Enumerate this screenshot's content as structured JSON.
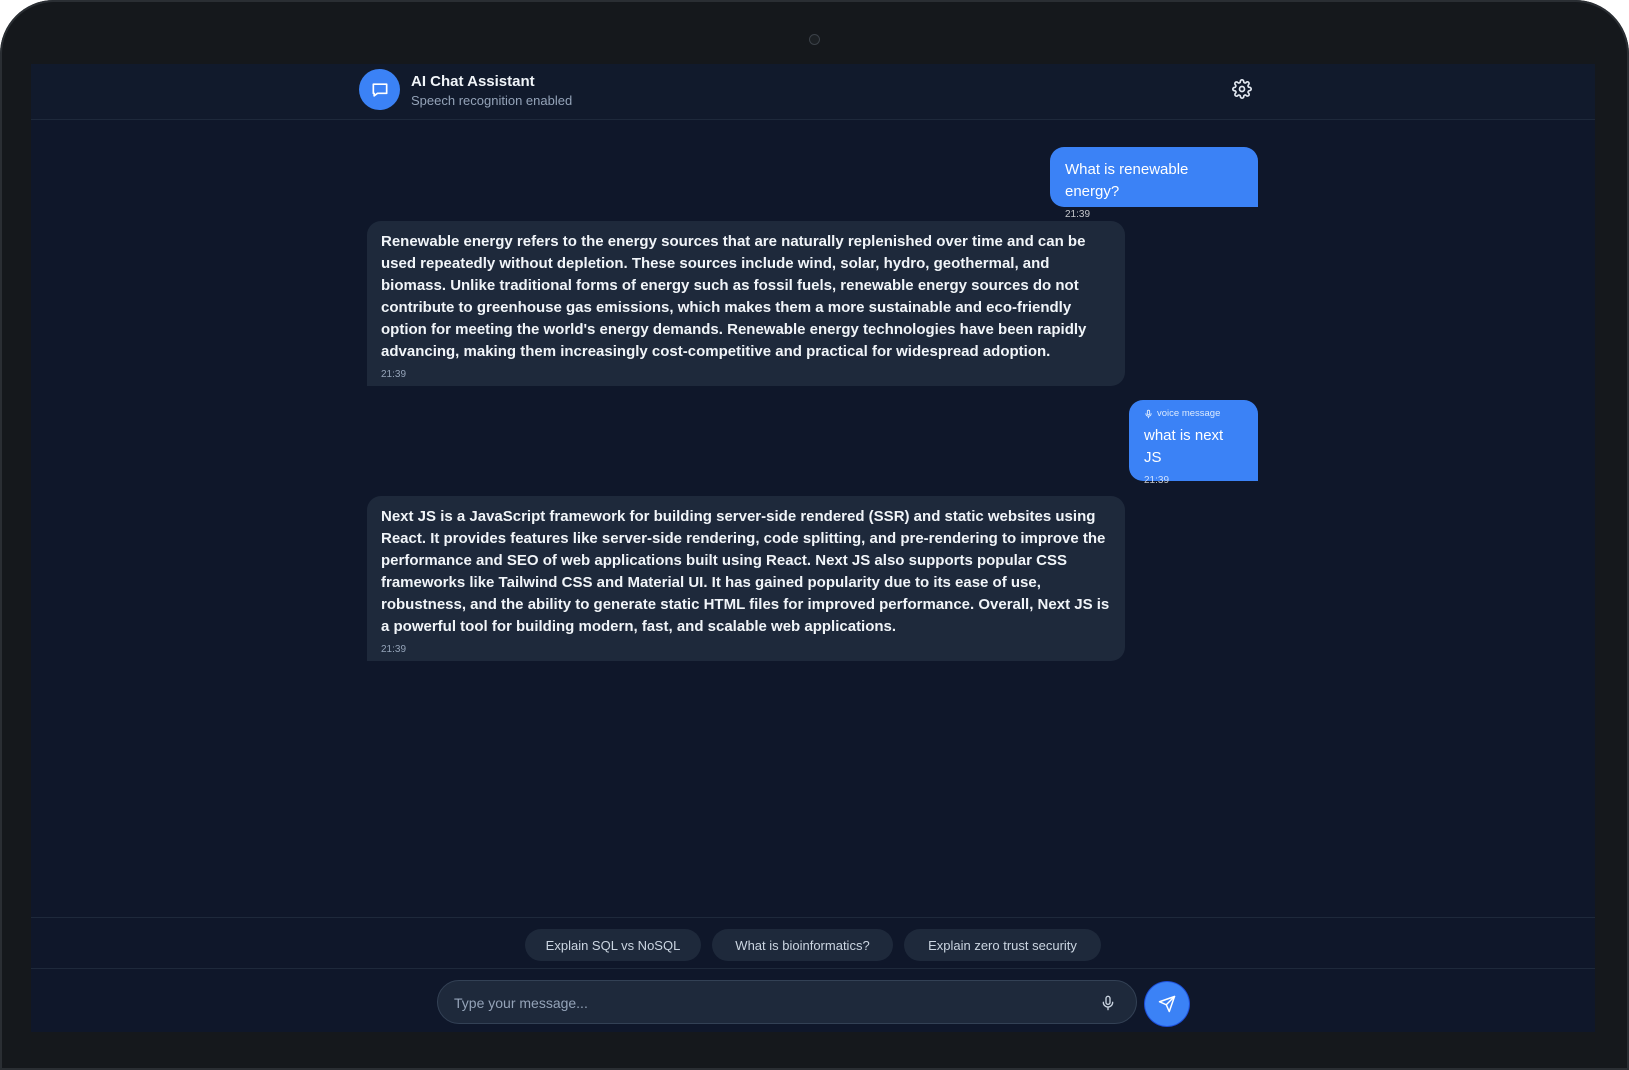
{
  "header": {
    "title": "AI Chat Assistant",
    "subtitle": "Speech recognition enabled",
    "avatar_icon": "chat-bubble-icon",
    "settings_icon": "gear-icon"
  },
  "messages": [
    {
      "role": "user",
      "text": "What is renewable energy?",
      "time": "21:39"
    },
    {
      "role": "assistant",
      "text": "Renewable energy refers to the energy sources that are naturally replenished over time and can be used repeatedly without depletion. These sources include wind, solar, hydro, geothermal, and biomass. Unlike traditional forms of energy such as fossil fuels, renewable energy sources do not contribute to greenhouse gas emissions, which makes them a more sustainable and eco-friendly option for meeting the world's energy demands. Renewable energy technologies have been rapidly advancing, making them increasingly cost-competitive and practical for widespread adoption.",
      "time": "21:39"
    },
    {
      "role": "user",
      "tag": "voice message",
      "text": "what is next JS",
      "time": "21:39"
    },
    {
      "role": "assistant",
      "text": "Next JS is a JavaScript framework for building server-side rendered (SSR) and static websites using React. It provides features like server-side rendering, code splitting, and pre-rendering to improve the performance and SEO of web applications built using React. Next JS also supports popular CSS frameworks like Tailwind CSS and Material UI. It has gained popularity due to its ease of use, robustness, and the ability to generate static HTML files for improved performance. Overall, Next JS is a powerful tool for building modern, fast, and scalable web applications.",
      "time": "21:39"
    }
  ],
  "suggestions": [
    "Explain SQL vs NoSQL",
    "What is bioinformatics?",
    "Explain zero trust security"
  ],
  "input": {
    "placeholder": "Type your message...",
    "value": "",
    "mic_icon": "microphone-icon",
    "send_icon": "send-icon"
  },
  "colors": {
    "accent": "#3b82f6",
    "background": "#0f172a",
    "ai_bubble": "#1e293b"
  }
}
